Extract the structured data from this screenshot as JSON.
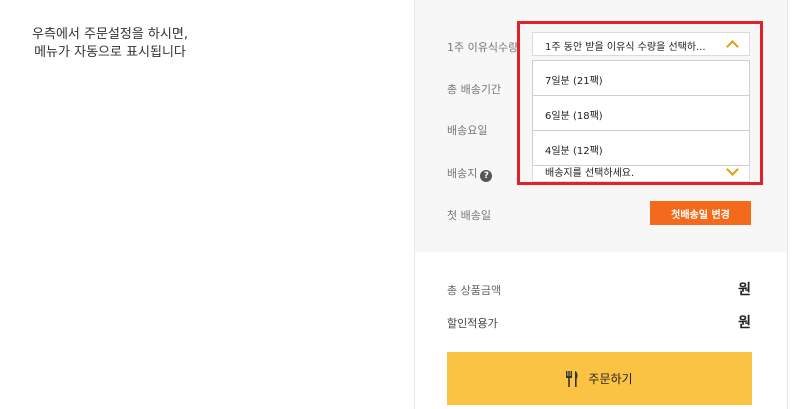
{
  "notice": {
    "line1": "우측에서 주문설정을 하시면,",
    "line2": "메뉴가 자동으로 표시됩니다"
  },
  "settings": {
    "weekly_quantity": {
      "label": "1주 이유식수량",
      "selected": "1주 동안 받을 이유식 수량을 선택하...",
      "options": [
        "7일분 (21팩)",
        "6일분 (18팩)",
        "4일분 (12팩)"
      ]
    },
    "delivery_period": {
      "label": "총 배송기간"
    },
    "delivery_day": {
      "label": "배송요일"
    },
    "delivery_address": {
      "label": "배송지",
      "selected": "배송지를 선택하세요."
    },
    "first_delivery": {
      "label": "첫 배송일",
      "button": "첫배송일 변경"
    }
  },
  "summary": {
    "total_label": "총 상품금액",
    "total_value": "원",
    "discount_label": "할인적용가",
    "discount_value": "원"
  },
  "order_button": {
    "label": "주문하기",
    "icon": "utensils-icon"
  },
  "colors": {
    "highlight": "#e4202a",
    "accent_orange": "#f36a1c",
    "order_yellow": "#fbc343",
    "chevron": "#e0a000"
  }
}
